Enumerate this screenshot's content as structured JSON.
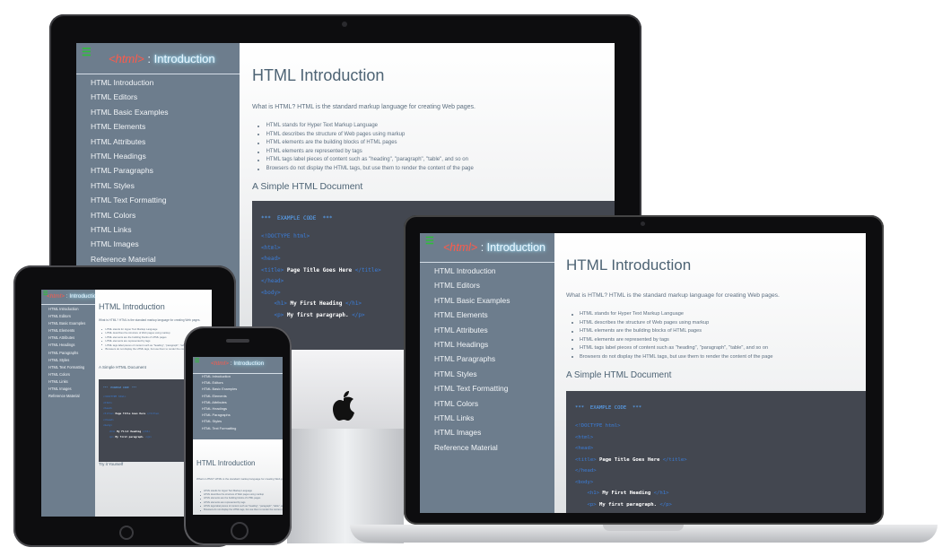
{
  "site": {
    "menu_icon": "menu-icon",
    "logo_tag": "<html>",
    "logo_colon": ":",
    "logo_title": "Introduction",
    "nav": [
      "HTML Introduction",
      "HTML Editors",
      "HTML Basic Examples",
      "HTML Elements",
      "HTML Attributes",
      "HTML Headings",
      "HTML Paragraphs",
      "HTML Styles",
      "HTML Text Formatting",
      "HTML Colors",
      "HTML Links",
      "HTML Images",
      "Reference Material"
    ],
    "page_title": "HTML Introduction",
    "intro": "What is HTML? HTML is the standard markup language for creating Web pages.",
    "bullets": [
      "HTML stands for Hyper Text Markup Language",
      "HTML describes the structure of Web pages using markup",
      "HTML elements are the building blocks of HTML pages",
      "HTML elements are represented by tags",
      "HTML tags label pieces of content such as \"heading\", \"paragraph\", \"table\", and so on",
      "Browsers do not display the HTML tags, but use them to render the content of the page"
    ],
    "section_title": "A Simple HTML Document",
    "code": {
      "comment": "***  EXAMPLE CODE  ***",
      "doctype": "<!DOCTYPE html>",
      "html_open": "<html>",
      "head_open": "<head>",
      "title_open": "<title>",
      "title_text": "Page Title Goes Here",
      "title_close": "</title>",
      "head_close": "</head>",
      "body_open": "<body>",
      "h1_open": "<h1>",
      "h1_text": "My First Heading",
      "h1_close": "</h1>",
      "p_open": "<p>",
      "p_text": "My first paragraph.",
      "p_close": "</p>"
    },
    "tablet_extra_heading": "Try it Yourself"
  },
  "colors": {
    "sidebar": "#6d7d8d",
    "code_bg": "#434750",
    "accent_green": "#2fbf3a",
    "logo_red": "#ff5a4a"
  }
}
